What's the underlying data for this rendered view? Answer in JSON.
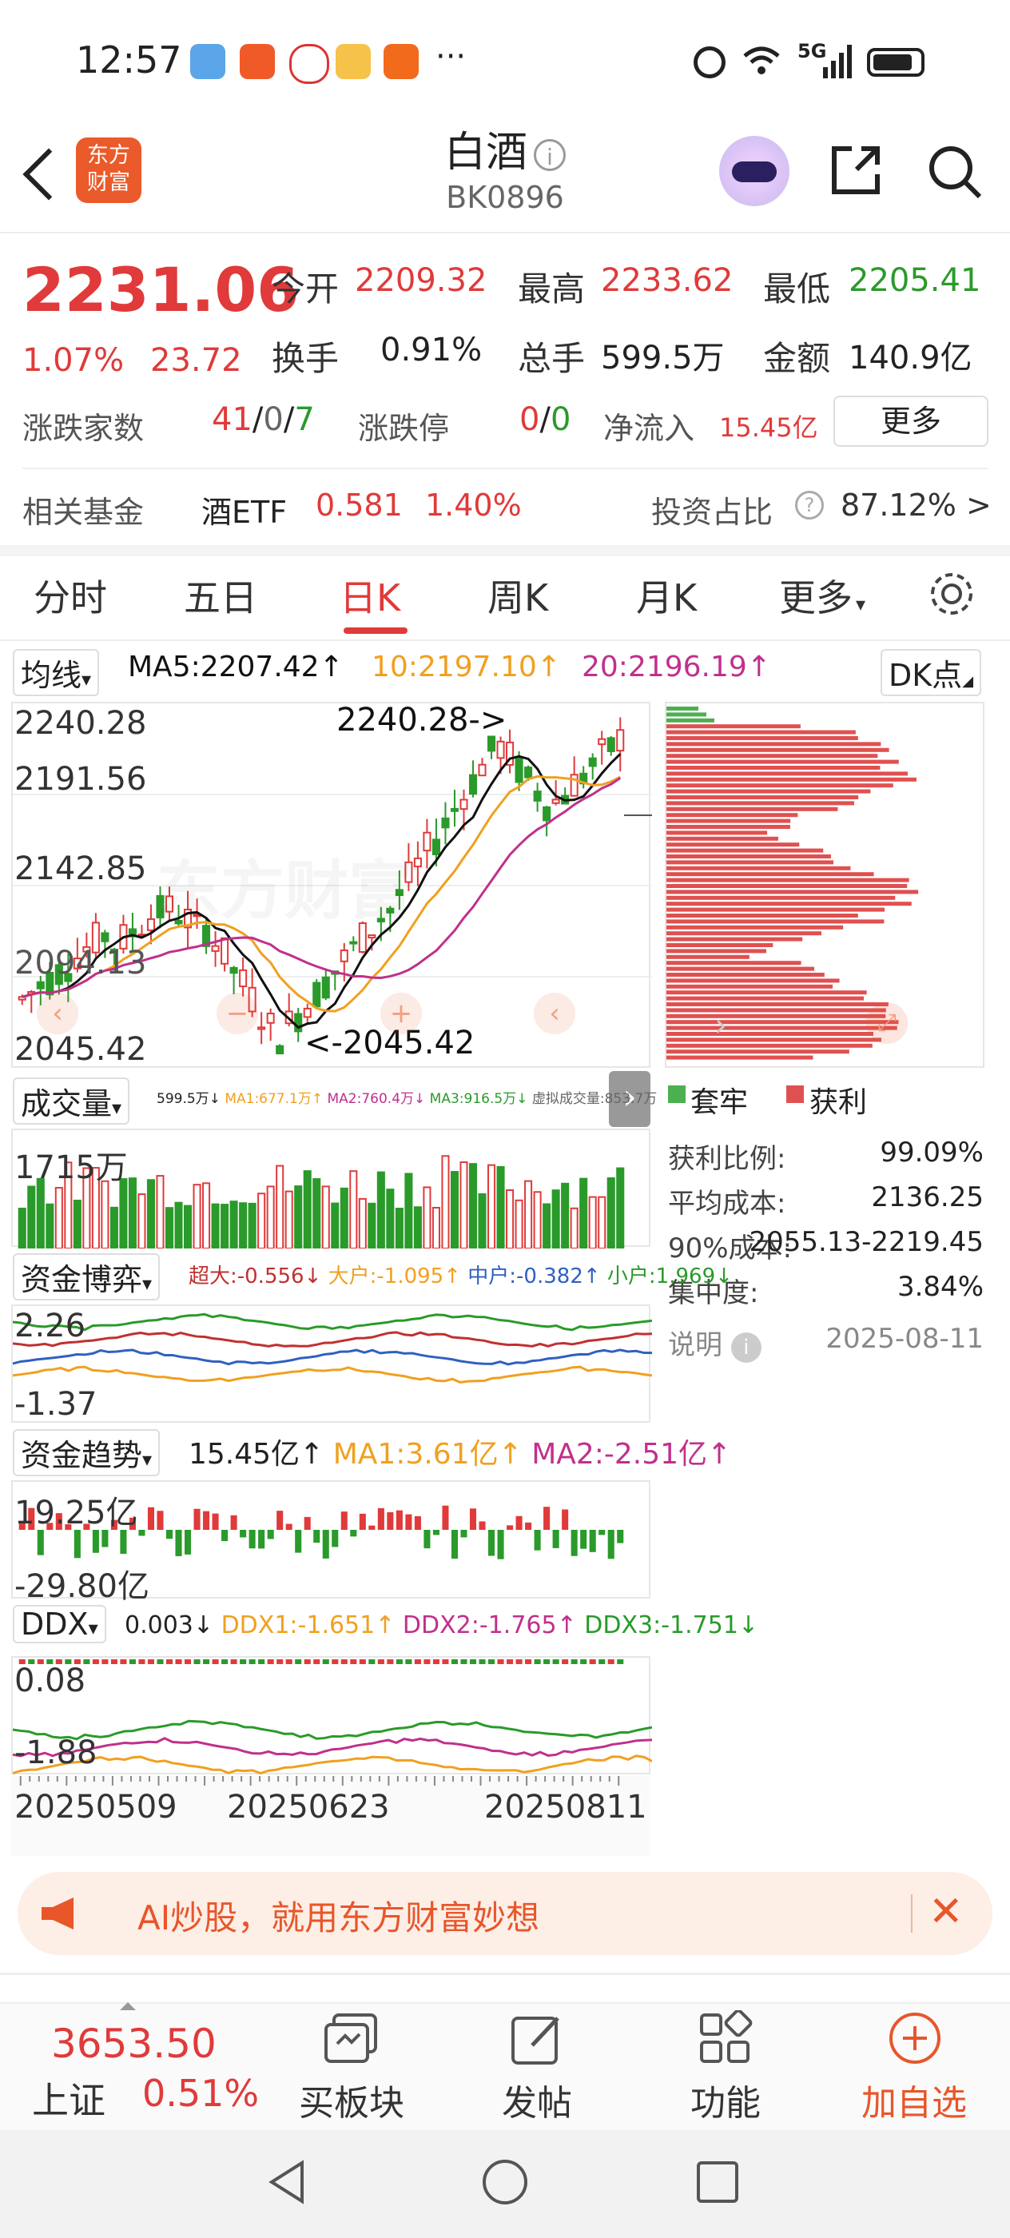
{
  "status_bar": {
    "time": "12:57",
    "more": "···",
    "network": "5G"
  },
  "header": {
    "title": "白酒",
    "code": "BK0896",
    "logo_line1": "东方",
    "logo_line2": "财富"
  },
  "quote": {
    "price": "2231.06",
    "change_pct": "1.07%",
    "change": "23.72",
    "open_label": "今开",
    "open": "2209.32",
    "high_label": "最高",
    "high": "2233.62",
    "low_label": "最低",
    "low": "2205.41",
    "turnover_label": "换手",
    "turnover": "0.91%",
    "volume_label": "总手",
    "volume": "599.5万",
    "amount_label": "金额",
    "amount": "140.9亿",
    "breadth_label": "涨跌家数",
    "up": "41",
    "flat": "0",
    "down": "7",
    "sep": "/",
    "limit_label": "涨跌停",
    "limit_up": "0",
    "limit_down": "0",
    "netflow_label": "净流入",
    "netflow": "15.45亿",
    "more_button": "更多"
  },
  "fund": {
    "label": "相关基金",
    "name": "酒ETF",
    "price": "0.581",
    "pct": "1.40%",
    "ratio_label": "投资占比",
    "ratio": "87.12%",
    "arrow": ">"
  },
  "tabs": [
    "分时",
    "五日",
    "日K",
    "周K",
    "月K",
    "更多"
  ],
  "active_tab": "日K",
  "kline": {
    "ma_select": "均线",
    "ma5": "MA5:2207.42↑",
    "ma10": "10:2197.10↑",
    "ma20": "20:2196.19↑",
    "dk_button": "DK点",
    "y_labels": [
      "2240.28",
      "2191.56",
      "2142.85",
      "2094.13",
      "2045.42"
    ],
    "max_note": "2240.28->",
    "min_note": "<-2045.42",
    "watermark": "东方财富"
  },
  "volume": {
    "select": "成交量",
    "vol": "599.5万↓",
    "ma1": "MA1:677.1万↑",
    "ma2": "MA2:760.4万↓",
    "ma3": "MA3:916.5万↓",
    "virtual": "虚拟成交量:853.7万",
    "y_label": "1715万"
  },
  "funds_game": {
    "select": "资金博弈",
    "big": "超大:-0.556↓",
    "large": "大户:-1.095↑",
    "mid": "中户:-0.382↑",
    "small": "小户:1.969↓",
    "y_top": "2.26",
    "y_bottom": "-1.37"
  },
  "funds_trend": {
    "select": "资金趋势",
    "value": "15.45亿↑",
    "ma1": "MA1:3.61亿↑",
    "ma2": "MA2:-2.51亿↑",
    "y_top": "19.25亿",
    "y_bottom": "-29.80亿"
  },
  "ddx": {
    "select": "DDX",
    "value": "0.003↓",
    "ddx1": "DDX1:-1.651↑",
    "ddx2": "DDX2:-1.765↑",
    "ddx3": "DDX3:-1.751↓",
    "y_top": "0.08",
    "y_bottom": "-1.88"
  },
  "x_dates": [
    "20250509",
    "20250623",
    "20250811"
  ],
  "chip": {
    "legend_trapped": "套牢",
    "legend_profit": "获利",
    "profit_ratio_label": "获利比例:",
    "profit_ratio": "99.09%",
    "avg_cost_label": "平均成本:",
    "avg_cost": "2136.25",
    "cost90_label": "90%成本:",
    "cost90": "2055.13-2219.45",
    "concentration_label": "集中度:",
    "concentration": "3.84%",
    "note_label": "说明",
    "date": "2025-08-11"
  },
  "banner": {
    "text": "AI炒股，就用东方财富妙想"
  },
  "bottom": {
    "index_value": "3653.50",
    "index_name": "上证",
    "index_pct": "0.51%",
    "nav": [
      "买板块",
      "发帖",
      "功能",
      "加自选"
    ]
  },
  "colors": {
    "up": "#e03a3a",
    "down": "#2a9a2a",
    "ma5": "#111111",
    "ma10": "#f0a020",
    "ma20": "#c0308c",
    "accent": "#e8562a"
  }
}
